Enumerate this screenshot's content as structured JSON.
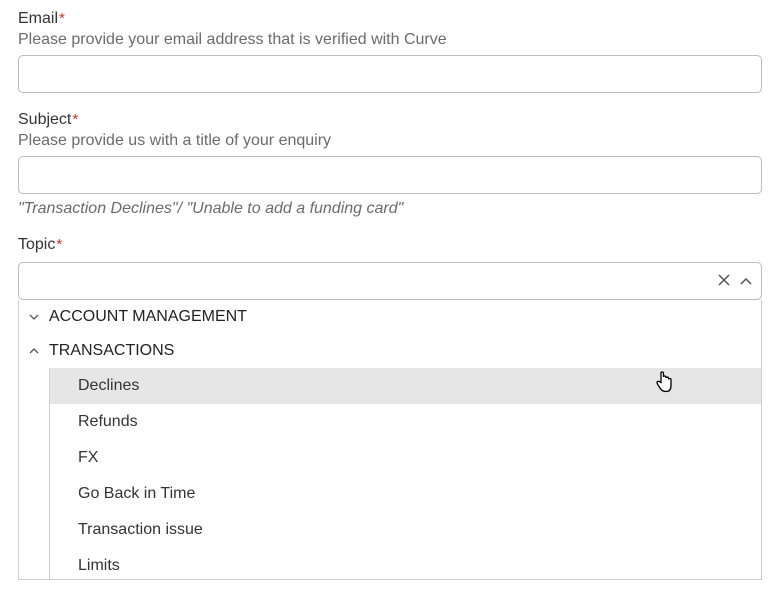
{
  "email": {
    "label": "Email",
    "required": "*",
    "helper": "Please provide your email address that is verified with Curve",
    "value": ""
  },
  "subject": {
    "label": "Subject",
    "required": "*",
    "helper": "Please provide us with a title of your enquiry",
    "value": "",
    "example": "\"Transaction Declines\"/ \"Unable to add a funding card\""
  },
  "topic": {
    "label": "Topic",
    "required": "*",
    "value": "",
    "groups": [
      {
        "name": "ACCOUNT MANAGEMENT",
        "expanded": false,
        "items": []
      },
      {
        "name": "TRANSACTIONS",
        "expanded": true,
        "items": [
          "Declines",
          "Refunds",
          "FX",
          "Go Back in Time",
          "Transaction issue",
          "Limits"
        ]
      }
    ]
  }
}
